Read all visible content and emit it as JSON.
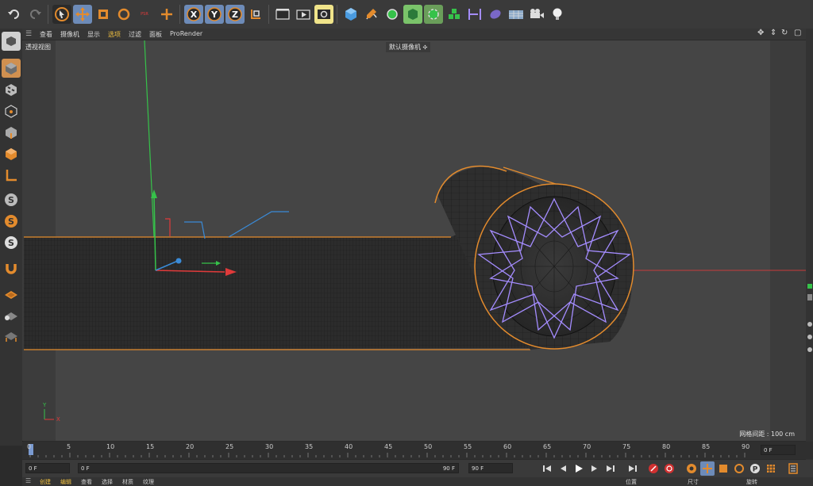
{
  "toolbar": {
    "tools": [
      "undo-icon",
      "redo-icon",
      "select-icon",
      "move-icon",
      "scale-icon",
      "rotate-icon",
      "psr-icon",
      "add-icon",
      "axis-x",
      "axis-y",
      "axis-z",
      "coordinate-system-icon",
      "render-region-icon",
      "render-view-icon",
      "render-settings-icon",
      "cube-icon",
      "pen-icon",
      "generator-icon",
      "spline-icon",
      "deformer-icon",
      "mograph-icon",
      "snap-icon",
      "effector-icon",
      "floor-icon",
      "camera-icon",
      "light-icon"
    ],
    "axis_x": "X",
    "axis_y": "Y",
    "axis_z": "Z",
    "psr": "PSR"
  },
  "viewport_menu": {
    "items": [
      "查看",
      "摄像机",
      "显示",
      "选项",
      "过滤",
      "面板",
      "ProRender"
    ],
    "active_index": 3
  },
  "viewport": {
    "label": "透视视图",
    "camera": "默认摄像机",
    "grid_spacing": "网格间距 : 100 cm",
    "axis_y": "Y",
    "axis_x": "X"
  },
  "timeline": {
    "ticks": [
      "0",
      "5",
      "10",
      "15",
      "20",
      "25",
      "30",
      "35",
      "40",
      "45",
      "50",
      "55",
      "60",
      "65",
      "70",
      "75",
      "80",
      "85",
      "90"
    ],
    "current_frame": "0 F"
  },
  "controls": {
    "start": "0 F",
    "range_start": "0 F",
    "range_end": "90 F",
    "end": "90 F"
  },
  "bottom_tabs": [
    "创建",
    "编辑",
    "查看",
    "选择",
    "材质",
    "纹理"
  ],
  "bottom_right": [
    "位置",
    "尺寸",
    "旋转"
  ],
  "colors": {
    "accent_orange": "#e38b2d",
    "axis_red": "#e03a3a",
    "axis_green": "#36c24a",
    "axis_blue": "#3a8bd8",
    "spline_purple": "#a48cff",
    "menu_active": "#f0c040"
  }
}
